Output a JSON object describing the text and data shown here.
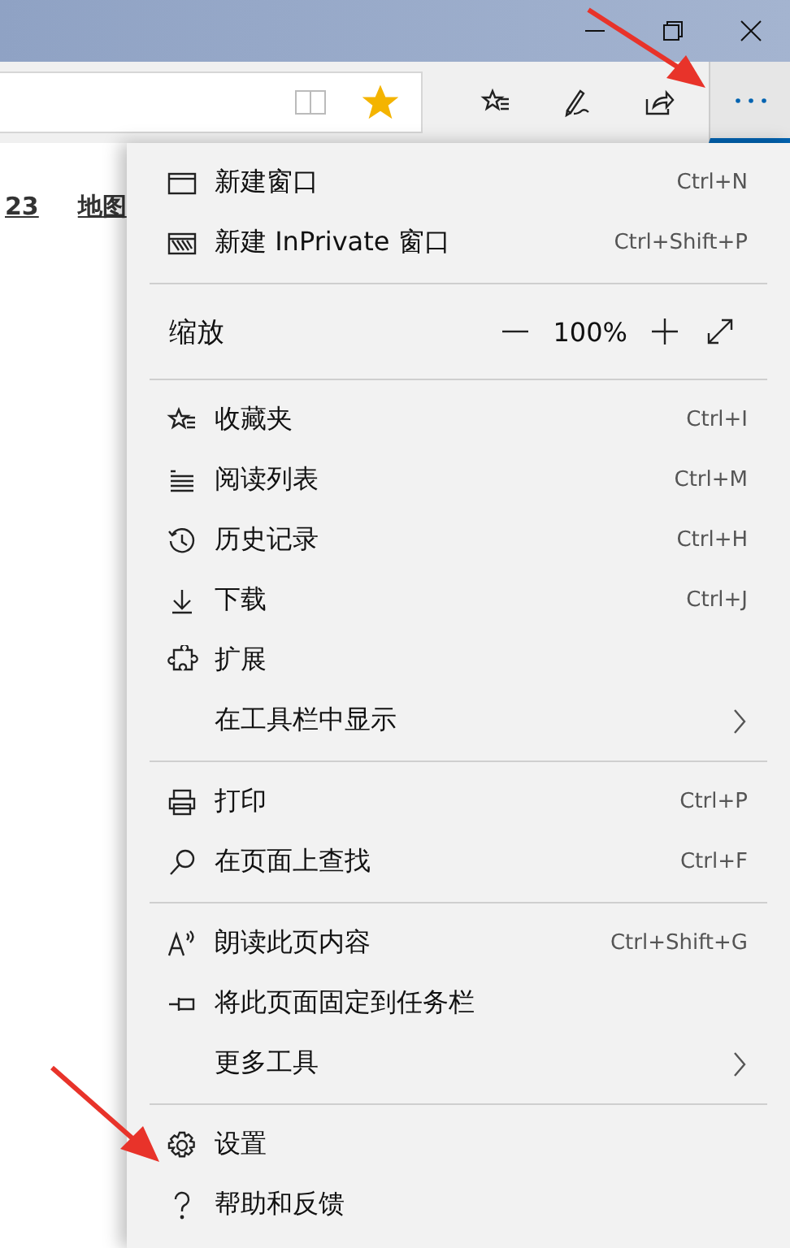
{
  "toolbar": {
    "favorited": true,
    "more_active": true
  },
  "page_links": [
    "23",
    "地图"
  ],
  "menu": {
    "groups": [
      {
        "items": [
          {
            "label": "新建窗口",
            "shortcut": "Ctrl+N",
            "submenu": false
          },
          {
            "label": "新建 InPrivate 窗口",
            "shortcut": "Ctrl+Shift+P",
            "submenu": false
          }
        ]
      },
      {
        "zoom": {
          "label": "缩放",
          "value": "100%"
        }
      },
      {
        "items": [
          {
            "label": "收藏夹",
            "shortcut": "Ctrl+I",
            "submenu": false
          },
          {
            "label": "阅读列表",
            "shortcut": "Ctrl+M",
            "submenu": false
          },
          {
            "label": "历史记录",
            "shortcut": "Ctrl+H",
            "submenu": false
          },
          {
            "label": "下载",
            "shortcut": "Ctrl+J",
            "submenu": false
          },
          {
            "label": "扩展",
            "submenu": false
          },
          {
            "label": "在工具栏中显示",
            "submenu": true
          }
        ]
      },
      {
        "items": [
          {
            "label": "打印",
            "shortcut": "Ctrl+P",
            "submenu": false
          },
          {
            "label": "在页面上查找",
            "shortcut": "Ctrl+F",
            "submenu": false
          }
        ]
      },
      {
        "items": [
          {
            "label": "朗读此页内容",
            "shortcut": "Ctrl+Shift+G",
            "submenu": false
          },
          {
            "label": "将此页面固定到任务栏",
            "submenu": false
          },
          {
            "label": "更多工具",
            "submenu": true
          }
        ]
      },
      {
        "items": [
          {
            "label": "设置",
            "submenu": false
          },
          {
            "label": "帮助和反馈",
            "submenu": false
          }
        ]
      }
    ]
  }
}
